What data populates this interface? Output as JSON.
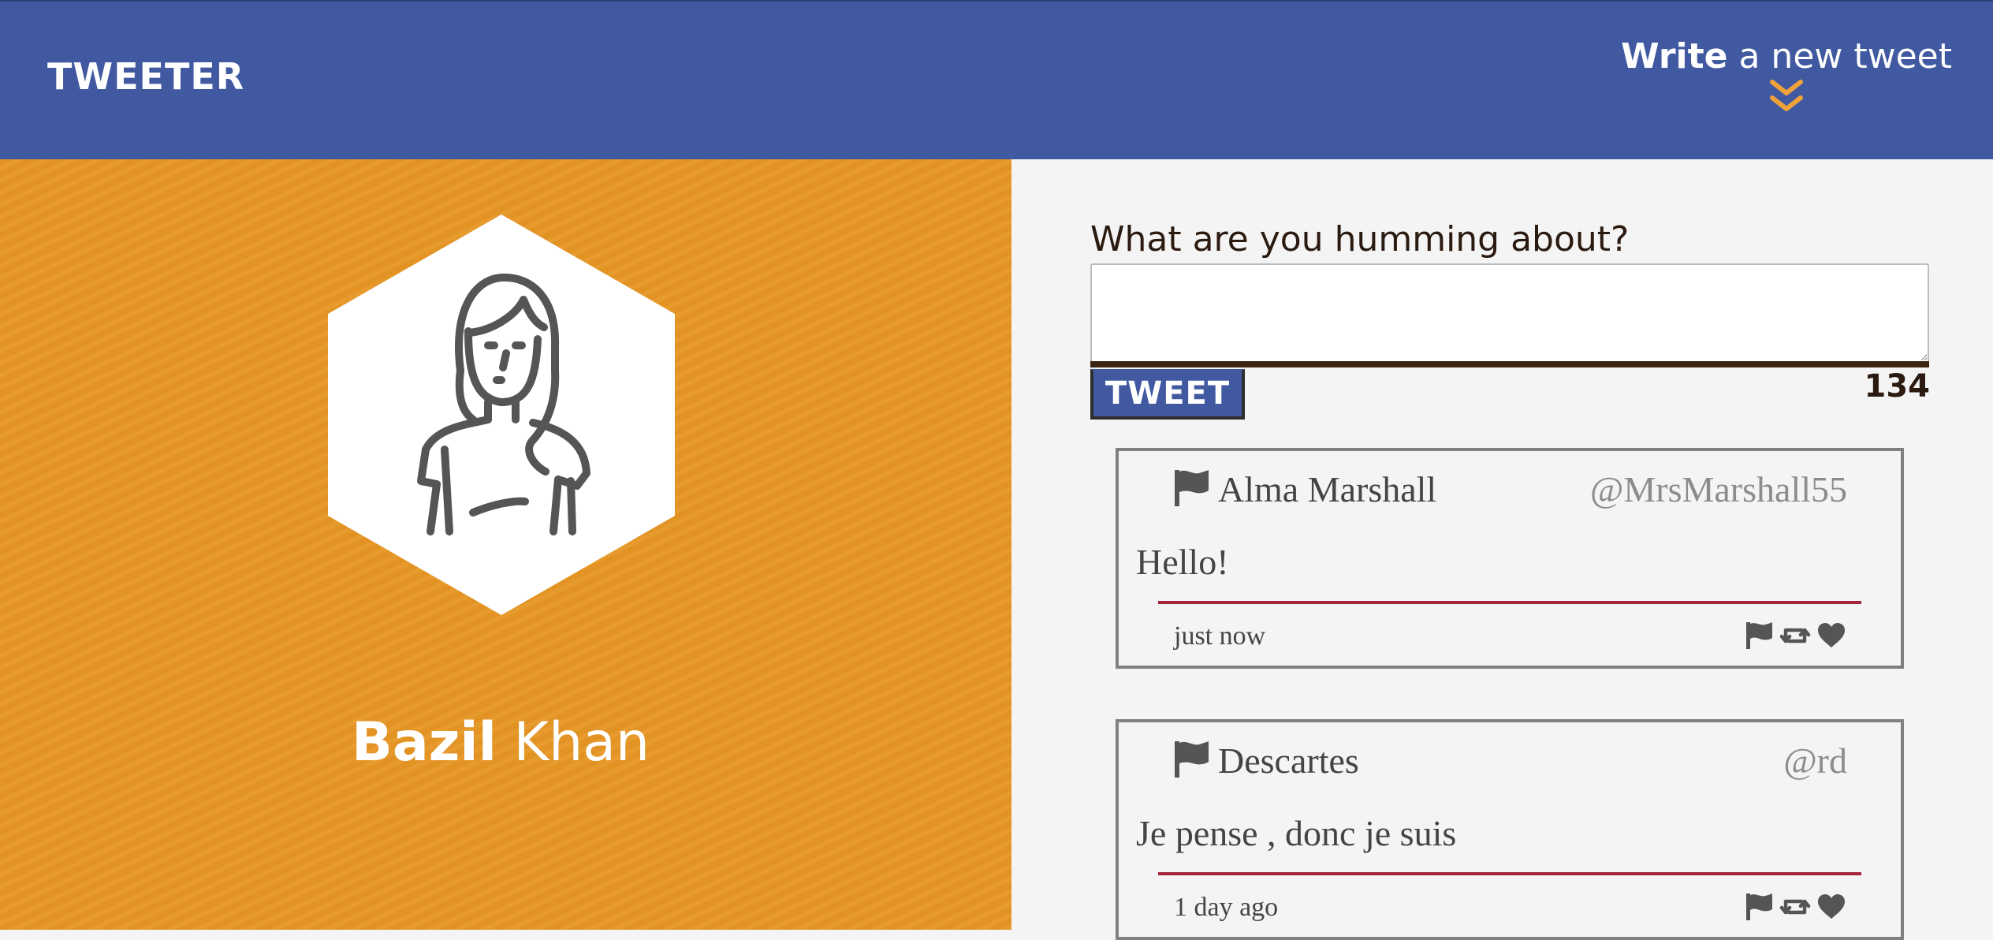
{
  "nav": {
    "brand": "TWEETER",
    "compose_bold": "Write",
    "compose_rest": " a new tweet"
  },
  "profile": {
    "first_name": "Bazil",
    "last_name": " Khan"
  },
  "compose": {
    "label": "What are you humming about?",
    "input_value": "",
    "button_label": "TWEET",
    "counter": "134"
  },
  "tweets": [
    {
      "name": "Alma Marshall",
      "handle": "@MrsMarshall55",
      "content": "Hello!",
      "time": "just now"
    },
    {
      "name": "Descartes",
      "handle": "@rd",
      "content": "Je pense , donc je suis",
      "time": "1 day ago"
    }
  ],
  "colors": {
    "nav": "#4059a0",
    "profile": "#e69625",
    "accent_chevron": "#f0a23a",
    "tweet_rule": "#a3243a",
    "icon": "#555555"
  },
  "icons": {
    "chevrons": "double-chevron-down-icon",
    "flag": "flag-icon",
    "retweet": "retweet-icon",
    "like": "heart-icon",
    "avatar": "woman-avatar-icon"
  }
}
